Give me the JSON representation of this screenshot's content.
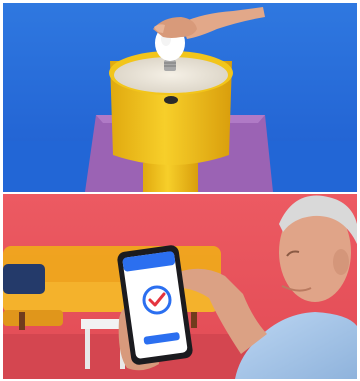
{
  "photos": [
    {
      "id": "lamp-bulb-photo",
      "subject": "hand-screwing-bulb-into-yellow-lamp",
      "colors": {
        "background": "#2a6fd6",
        "floor": "#1e5fcf",
        "lamp": "#f2c51b",
        "table": "#9a5fb0"
      }
    },
    {
      "id": "smartphone-app-photo",
      "subject": "older-man-using-smartphone-in-red-living-room",
      "colors": {
        "wall": "#e8525a",
        "sofa": "#f2b11e",
        "floor": "#d94a52",
        "screen": "#ffffff",
        "accent": "#2b6ff0"
      }
    }
  ],
  "phone": {
    "header_label": "",
    "screen_title": ""
  }
}
